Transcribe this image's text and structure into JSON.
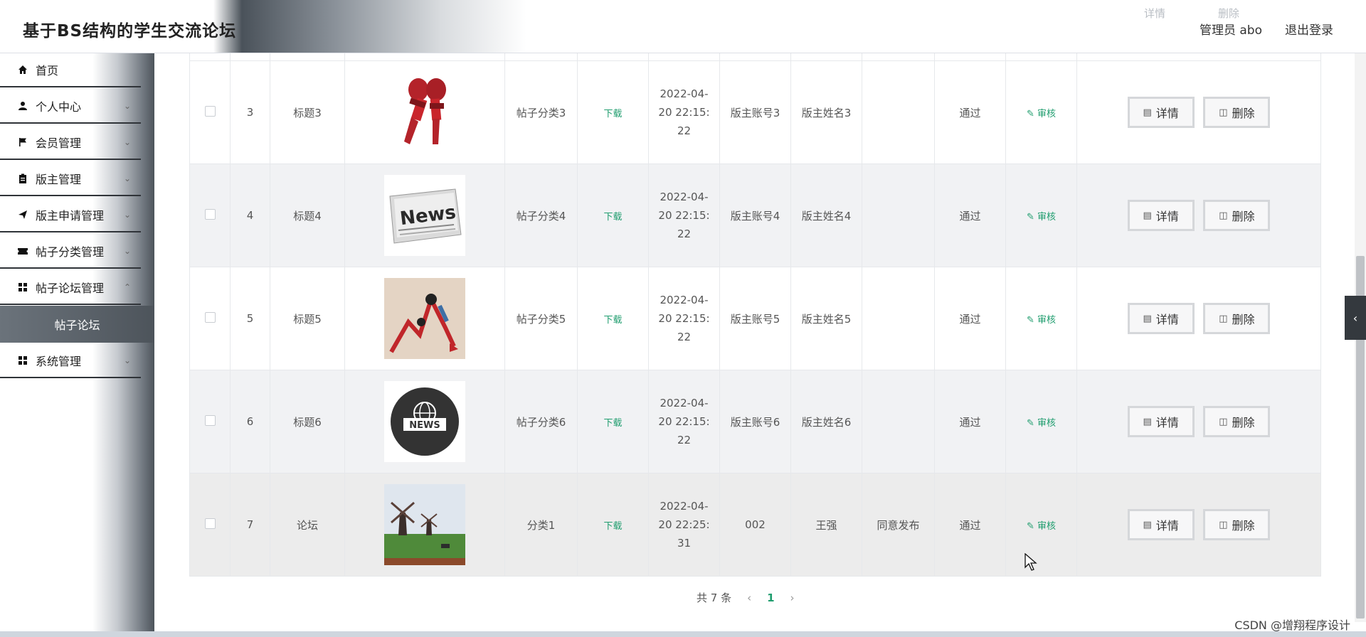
{
  "header": {
    "title": "基于BS结构的学生交流论坛",
    "user": "管理员 abo",
    "logout": "退出登录",
    "ghost_detail": "详情",
    "ghost_delete": "删除"
  },
  "sidebar": {
    "items": [
      {
        "label": "首页",
        "icon": "home-icon"
      },
      {
        "label": "个人中心",
        "icon": "user-icon"
      },
      {
        "label": "会员管理",
        "icon": "flag-icon"
      },
      {
        "label": "版主管理",
        "icon": "clipboard-icon"
      },
      {
        "label": "版主申请管理",
        "icon": "send-icon"
      },
      {
        "label": "帖子分类管理",
        "icon": "ticket-icon"
      },
      {
        "label": "帖子论坛管理",
        "icon": "grid-icon"
      },
      {
        "label": "系统管理",
        "icon": "grid-icon"
      }
    ],
    "active_sub": "帖子论坛"
  },
  "table": {
    "download_label": "下载",
    "audit_label": "审核",
    "detail_label": "详情",
    "delete_label": "删除",
    "rows": [
      {
        "id": "3",
        "title": "标题3",
        "image": "microphone-news-image",
        "category": "帖子分类3",
        "date": [
          "2022-04-",
          "20 22:15:",
          "22"
        ],
        "account": "版主账号3",
        "name": "版主姓名3",
        "reply": "",
        "status": "通过"
      },
      {
        "id": "4",
        "title": "标题4",
        "image": "newspaper-image",
        "category": "帖子分类4",
        "date": [
          "2022-04-",
          "20 22:15:",
          "22"
        ],
        "account": "版主账号4",
        "name": "版主姓名4",
        "reply": "",
        "status": "通过"
      },
      {
        "id": "5",
        "title": "标题5",
        "image": "chart-crash-image",
        "category": "帖子分类5",
        "date": [
          "2022-04-",
          "20 22:15:",
          "22"
        ],
        "account": "版主账号5",
        "name": "版主姓名5",
        "reply": "",
        "status": "通过"
      },
      {
        "id": "6",
        "title": "标题6",
        "image": "news-globe-image",
        "category": "帖子分类6",
        "date": [
          "2022-04-",
          "20 22:15:",
          "22"
        ],
        "account": "版主账号6",
        "name": "版主姓名6",
        "reply": "",
        "status": "通过"
      },
      {
        "id": "7",
        "title": "论坛",
        "image": "windmill-landscape-image",
        "category": "分类1",
        "date": [
          "2022-04-",
          "20 22:25:",
          "31"
        ],
        "account": "002",
        "name": "王强",
        "reply": "同意发布",
        "status": "通过"
      }
    ]
  },
  "pagination": {
    "total": "共 7 条",
    "current": "1"
  },
  "watermark": "CSDN @增翔程序设计"
}
